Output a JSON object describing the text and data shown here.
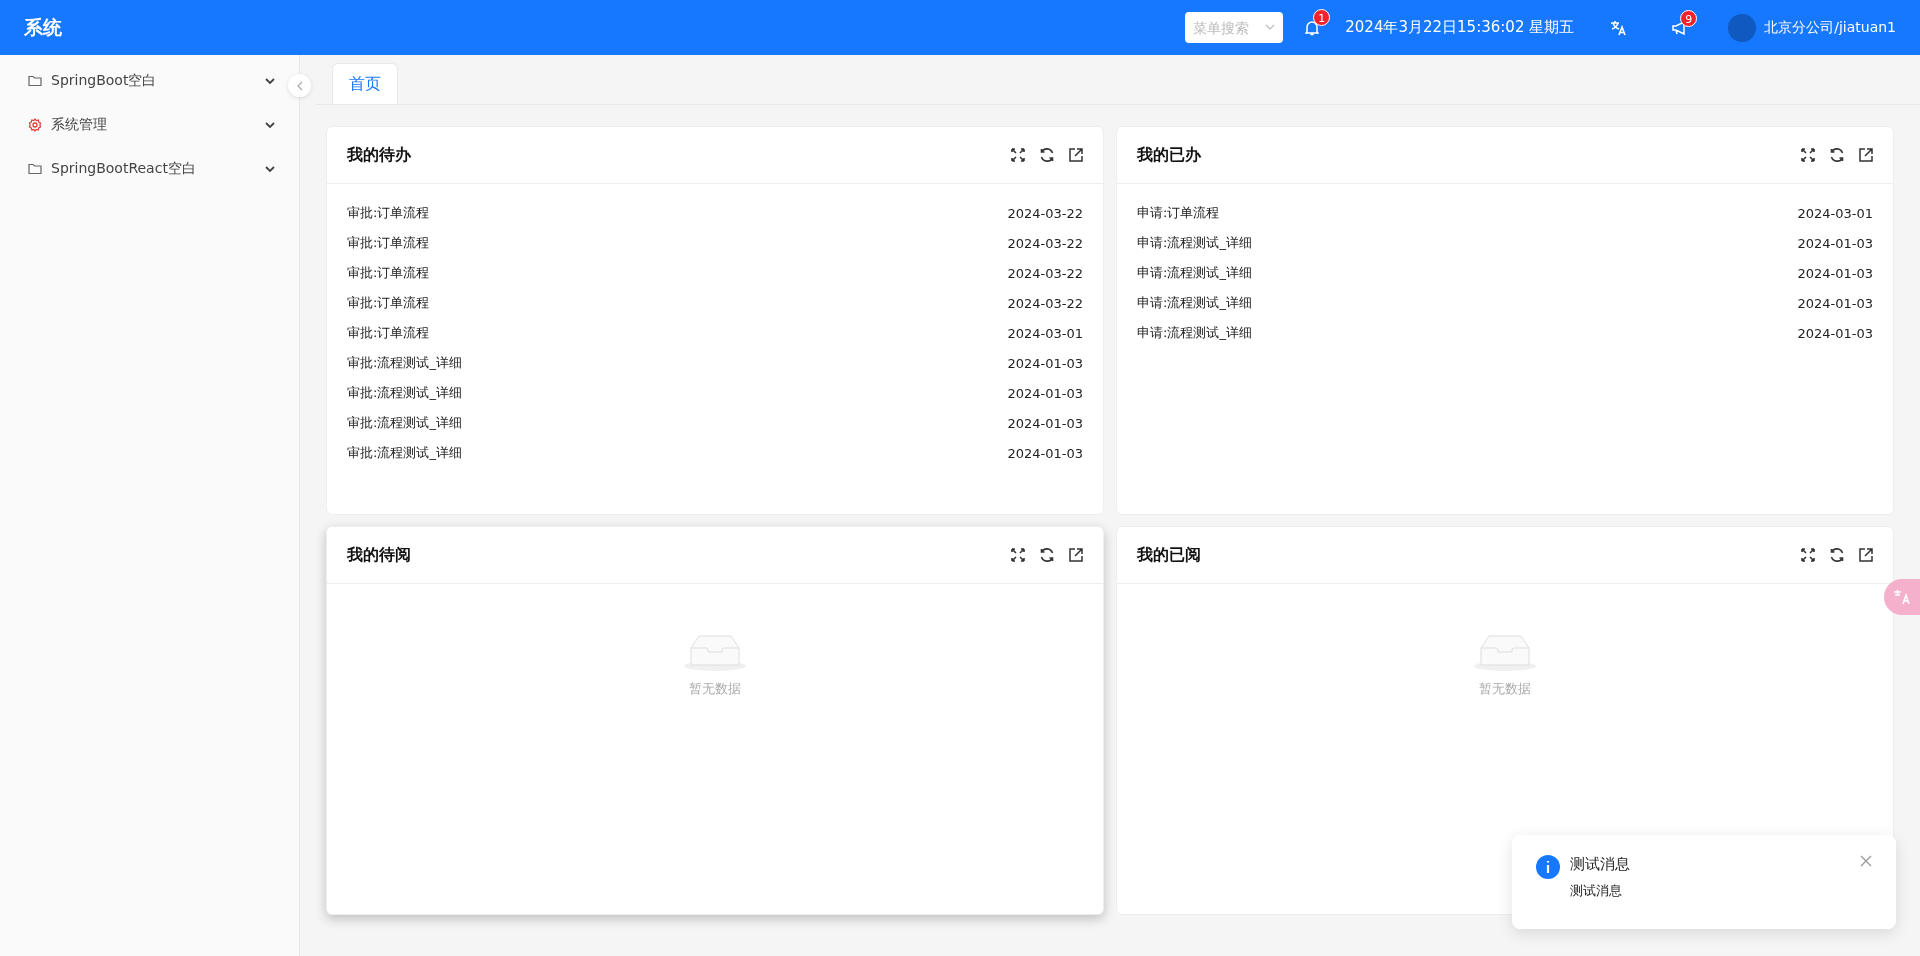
{
  "header": {
    "title": "系统",
    "menu_search": {
      "placeholder": "菜单搜索"
    },
    "notifications_badge": "1",
    "datetime": "2024年3月22日15:36:02 星期五",
    "announcements_badge": "9",
    "user": "北京分公司/jiatuan1"
  },
  "sidebar": {
    "items": [
      {
        "label": "SpringBoot空白",
        "kind": "folder"
      },
      {
        "label": "系统管理",
        "kind": "settings"
      },
      {
        "label": "SpringBootReact空白",
        "kind": "folder"
      }
    ]
  },
  "tabs": [
    {
      "label": "首页",
      "selected": true
    }
  ],
  "cards": [
    {
      "title": "我的待办",
      "raised": false,
      "items": [
        {
          "name": "审批:订单流程",
          "date": "2024-03-22"
        },
        {
          "name": "审批:订单流程",
          "date": "2024-03-22"
        },
        {
          "name": "审批:订单流程",
          "date": "2024-03-22"
        },
        {
          "name": "审批:订单流程",
          "date": "2024-03-22"
        },
        {
          "name": "审批:订单流程",
          "date": "2024-03-01"
        },
        {
          "name": "审批:流程测试_详细",
          "date": "2024-01-03"
        },
        {
          "name": "审批:流程测试_详细",
          "date": "2024-01-03"
        },
        {
          "name": "审批:流程测试_详细",
          "date": "2024-01-03"
        },
        {
          "name": "审批:流程测试_详细",
          "date": "2024-01-03"
        }
      ]
    },
    {
      "title": "我的已办",
      "raised": false,
      "items": [
        {
          "name": "申请:订单流程",
          "date": "2024-03-01"
        },
        {
          "name": "申请:流程测试_详细",
          "date": "2024-01-03"
        },
        {
          "name": "申请:流程测试_详细",
          "date": "2024-01-03"
        },
        {
          "name": "申请:流程测试_详细",
          "date": "2024-01-03"
        },
        {
          "name": "申请:流程测试_详细",
          "date": "2024-01-03"
        }
      ]
    },
    {
      "title": "我的待阅",
      "raised": true,
      "empty_text": "暂无数据"
    },
    {
      "title": "我的已阅",
      "raised": false,
      "empty_text": "暂无数据"
    }
  ],
  "notification": {
    "title": "测试消息",
    "message": "测试消息"
  }
}
